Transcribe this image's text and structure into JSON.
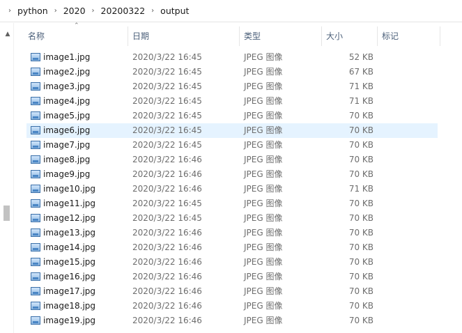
{
  "breadcrumb": [
    "python",
    "2020",
    "20200322",
    "output"
  ],
  "columns": {
    "name": "名称",
    "date": "日期",
    "type": "类型",
    "size": "大小",
    "tag": "标记"
  },
  "selected_index": 5,
  "files": [
    {
      "name": "image1.jpg",
      "date": "2020/3/22 16:45",
      "type": "JPEG 图像",
      "size": "52 KB"
    },
    {
      "name": "image2.jpg",
      "date": "2020/3/22 16:45",
      "type": "JPEG 图像",
      "size": "67 KB"
    },
    {
      "name": "image3.jpg",
      "date": "2020/3/22 16:45",
      "type": "JPEG 图像",
      "size": "71 KB"
    },
    {
      "name": "image4.jpg",
      "date": "2020/3/22 16:45",
      "type": "JPEG 图像",
      "size": "71 KB"
    },
    {
      "name": "image5.jpg",
      "date": "2020/3/22 16:45",
      "type": "JPEG 图像",
      "size": "70 KB"
    },
    {
      "name": "image6.jpg",
      "date": "2020/3/22 16:45",
      "type": "JPEG 图像",
      "size": "70 KB"
    },
    {
      "name": "image7.jpg",
      "date": "2020/3/22 16:45",
      "type": "JPEG 图像",
      "size": "70 KB"
    },
    {
      "name": "image8.jpg",
      "date": "2020/3/22 16:46",
      "type": "JPEG 图像",
      "size": "70 KB"
    },
    {
      "name": "image9.jpg",
      "date": "2020/3/22 16:46",
      "type": "JPEG 图像",
      "size": "70 KB"
    },
    {
      "name": "image10.jpg",
      "date": "2020/3/22 16:46",
      "type": "JPEG 图像",
      "size": "71 KB"
    },
    {
      "name": "image11.jpg",
      "date": "2020/3/22 16:45",
      "type": "JPEG 图像",
      "size": "70 KB"
    },
    {
      "name": "image12.jpg",
      "date": "2020/3/22 16:45",
      "type": "JPEG 图像",
      "size": "70 KB"
    },
    {
      "name": "image13.jpg",
      "date": "2020/3/22 16:46",
      "type": "JPEG 图像",
      "size": "70 KB"
    },
    {
      "name": "image14.jpg",
      "date": "2020/3/22 16:46",
      "type": "JPEG 图像",
      "size": "70 KB"
    },
    {
      "name": "image15.jpg",
      "date": "2020/3/22 16:46",
      "type": "JPEG 图像",
      "size": "70 KB"
    },
    {
      "name": "image16.jpg",
      "date": "2020/3/22 16:46",
      "type": "JPEG 图像",
      "size": "70 KB"
    },
    {
      "name": "image17.jpg",
      "date": "2020/3/22 16:46",
      "type": "JPEG 图像",
      "size": "70 KB"
    },
    {
      "name": "image18.jpg",
      "date": "2020/3/22 16:46",
      "type": "JPEG 图像",
      "size": "70 KB"
    },
    {
      "name": "image19.jpg",
      "date": "2020/3/22 16:46",
      "type": "JPEG 图像",
      "size": "70 KB"
    }
  ]
}
